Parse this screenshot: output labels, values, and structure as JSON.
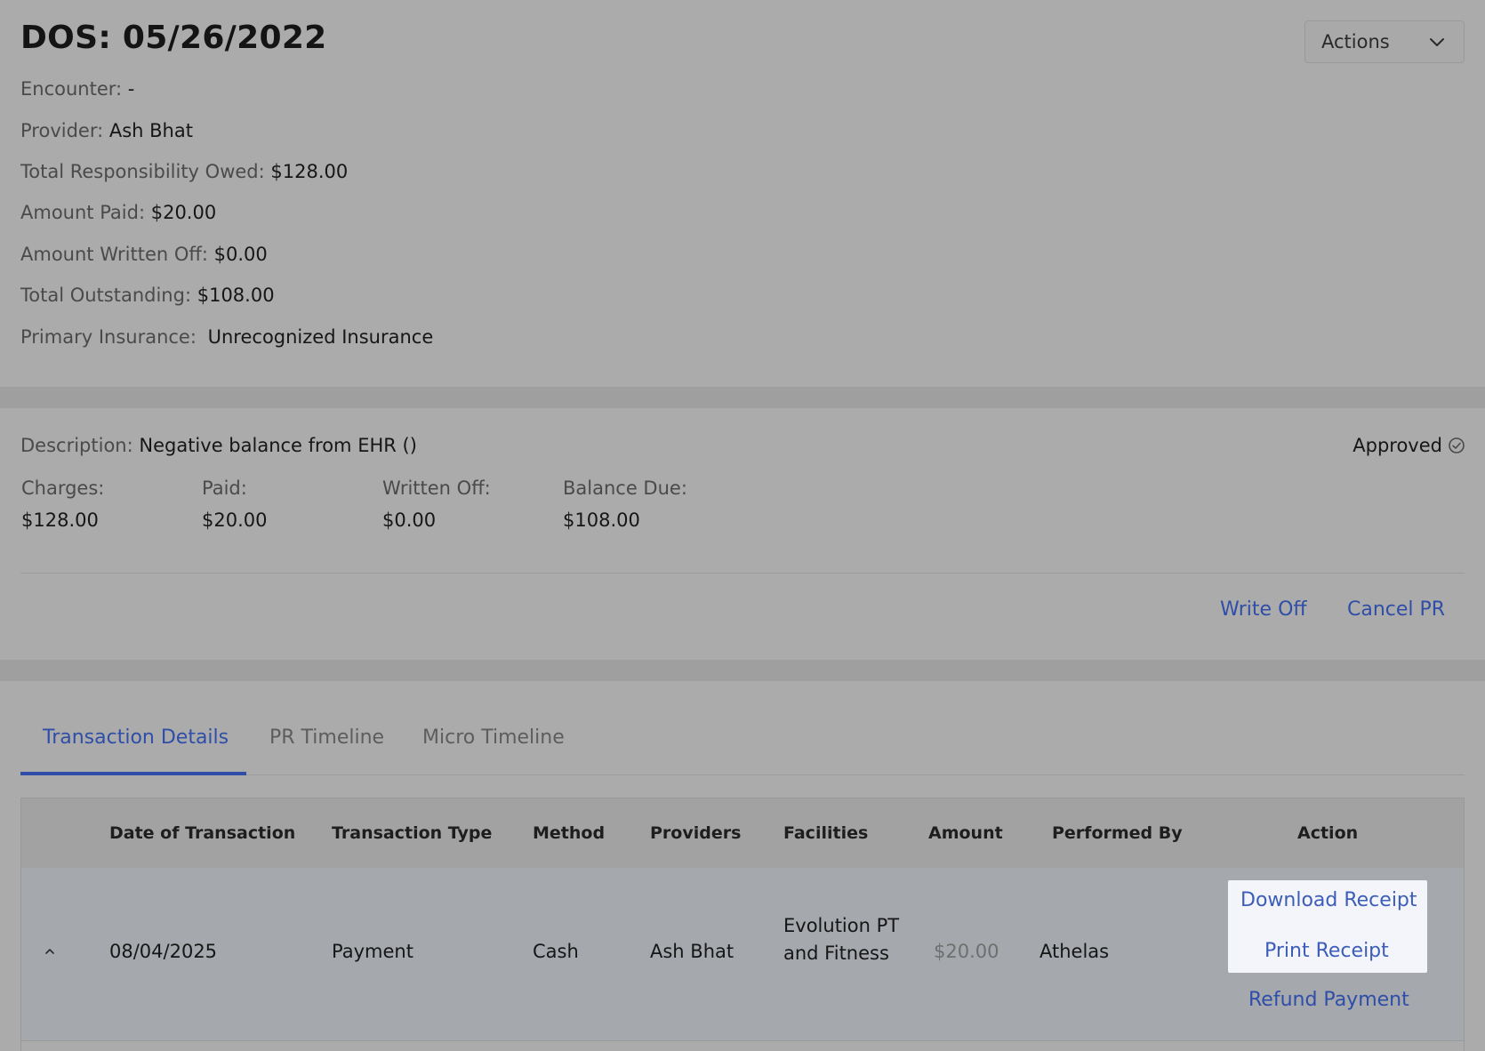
{
  "header": {
    "dos_title": "DOS: 05/26/2022",
    "actions_label": "Actions"
  },
  "summary": [
    {
      "label": "Encounter:",
      "value": "-"
    },
    {
      "label": "Provider:",
      "value": "Ash Bhat"
    },
    {
      "label": "Total Responsibility Owed:",
      "value": "$128.00"
    },
    {
      "label": "Amount Paid:",
      "value": "$20.00"
    },
    {
      "label": "Amount Written Off:",
      "value": "$0.00"
    },
    {
      "label": "Total Outstanding:",
      "value": "$108.00"
    },
    {
      "label": "Primary Insurance:",
      "value": "Unrecognized Insurance"
    }
  ],
  "pr": {
    "description_label": "Description:",
    "description_value": "Negative balance from EHR ()",
    "status": "Approved",
    "stats": [
      {
        "label": "Charges:",
        "value": "$128.00"
      },
      {
        "label": "Paid:",
        "value": "$20.00"
      },
      {
        "label": "Written Off:",
        "value": "$0.00"
      },
      {
        "label": "Balance Due:",
        "value": "$108.00"
      }
    ],
    "write_off_label": "Write Off",
    "cancel_label": "Cancel PR"
  },
  "tabs": [
    {
      "label": "Transaction Details",
      "active": true
    },
    {
      "label": "PR Timeline",
      "active": false
    },
    {
      "label": "Micro Timeline",
      "active": false
    }
  ],
  "table": {
    "columns": [
      "Date of Transaction",
      "Transaction Type",
      "Method",
      "Providers",
      "Facilities",
      "Amount",
      "Performed By",
      "Action"
    ],
    "rows": [
      {
        "date": "08/04/2025",
        "type": "Payment",
        "method": "Cash",
        "provider": "Ash Bhat",
        "facility": "Evolution PT and Fitness",
        "amount": "$20.00",
        "performed_by": "Athelas",
        "actions": [
          "Download Receipt",
          "Print Receipt",
          "Refund Payment"
        ]
      }
    ]
  },
  "colors": {
    "accent": "#2f4ea8",
    "overlay": "#ababab",
    "receipt_menu_bg": "#f3f5fa"
  }
}
